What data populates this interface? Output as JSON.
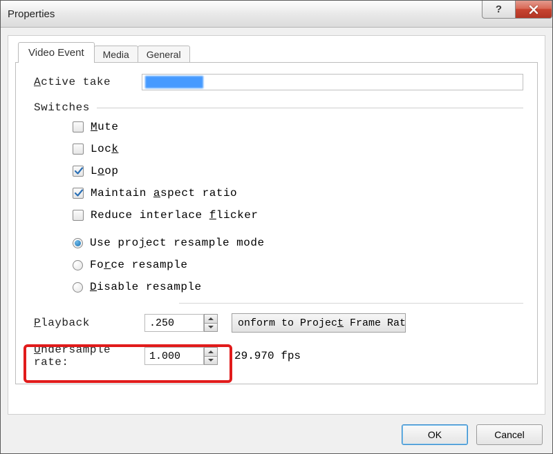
{
  "window": {
    "title": "Properties",
    "help_glyph": "?",
    "ok_label": "OK",
    "cancel_label": "Cancel"
  },
  "tabs": {
    "video_event": "Video Event",
    "media": "Media",
    "general": "General"
  },
  "active_take": {
    "label_pre": "A",
    "label_post": "ctive take",
    "value": ""
  },
  "switches": {
    "header": "Switches",
    "mute_u": "M",
    "mute_r": "ute",
    "lock_pre": "Loc",
    "lock_u": "k",
    "loop_pre": "L",
    "loop_u": "o",
    "loop_post": "op",
    "aspect_pre": "Maintain ",
    "aspect_u": "a",
    "aspect_post": "spect ratio",
    "flicker_pre": "Reduce interlace ",
    "flicker_u": "f",
    "flicker_post": "licker",
    "resample_proj_pre": "Use pro",
    "resample_proj_u": "j",
    "resample_proj_post": "ect resample mode",
    "resample_force_pre": "Fo",
    "resample_force_u": "r",
    "resample_force_post": "ce resample",
    "resample_disable_u": "D",
    "resample_disable_post": "isable resample"
  },
  "playback": {
    "label_u": "P",
    "label_post": "layback",
    "value": ".250"
  },
  "conform": {
    "label_pre": "onform to Projec",
    "label_u": "t",
    "label_post": " Frame Rat"
  },
  "undersample": {
    "label_u": "U",
    "label_post": "ndersample rate:",
    "value": "1.000",
    "fps": "29.970 fps"
  },
  "checkbox_states": {
    "mute": false,
    "lock": false,
    "loop": true,
    "aspect": true,
    "flicker": false
  },
  "resample_selected": "project"
}
